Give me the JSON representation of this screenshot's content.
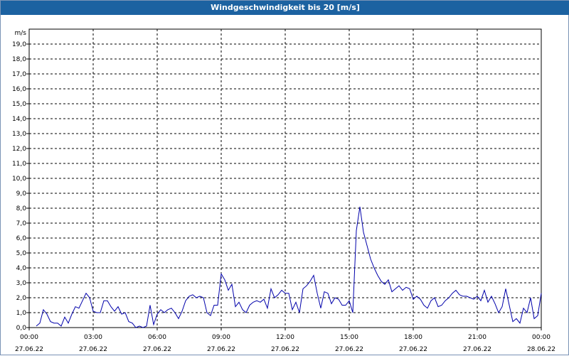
{
  "window": {
    "title": "Windgeschwindigkeit bis 20 [m/s]"
  },
  "colors": {
    "title_bar": "#1c62a1",
    "series": "#0000aa",
    "grid": "#000000"
  },
  "chart_data": {
    "type": "line",
    "title": "Windgeschwindigkeit bis 20 [m/s]",
    "ylabel": "m/s",
    "xlabel": "",
    "ylim": [
      0,
      20
    ],
    "xlim": [
      "2022-06-27 00:00",
      "2022-06-28 00:00"
    ],
    "grid": true,
    "y_ticks": [
      "0,0",
      "1,0",
      "2,0",
      "3,0",
      "4,0",
      "5,0",
      "6,0",
      "7,0",
      "8,0",
      "9,0",
      "10,0",
      "11,0",
      "12,0",
      "13,0",
      "14,0",
      "15,0",
      "16,0",
      "17,0",
      "18,0",
      "19,0"
    ],
    "x_ticks": [
      {
        "time": "00:00",
        "date": "27.06.22"
      },
      {
        "time": "03:00",
        "date": "27.06.22"
      },
      {
        "time": "06:00",
        "date": "27.06.22"
      },
      {
        "time": "09:00",
        "date": "27.06.22"
      },
      {
        "time": "12:00",
        "date": "27.06.22"
      },
      {
        "time": "15:00",
        "date": "27.06.22"
      },
      {
        "time": "18:00",
        "date": "27.06.22"
      },
      {
        "time": "21:00",
        "date": "27.06.22"
      },
      {
        "time": "00:00",
        "date": "28.06.22"
      }
    ],
    "series": [
      {
        "x": [
          "00:20",
          "00:30",
          "00:40",
          "00:50",
          "01:00",
          "01:10",
          "01:20",
          "01:30",
          "01:40",
          "01:50",
          "02:00",
          "02:10",
          "02:20",
          "02:30",
          "02:40",
          "02:50",
          "03:00",
          "03:10",
          "03:20",
          "03:30",
          "03:40",
          "03:50",
          "04:00",
          "04:10",
          "04:20",
          "04:30",
          "04:40",
          "04:50",
          "05:00",
          "05:10",
          "05:20",
          "05:30",
          "05:40",
          "05:50",
          "06:00",
          "06:10",
          "06:20",
          "06:30",
          "06:40",
          "06:50",
          "07:00",
          "07:10",
          "07:20",
          "07:30",
          "07:40",
          "07:50",
          "08:00",
          "08:10",
          "08:20",
          "08:30",
          "08:40",
          "08:50",
          "09:00",
          "09:10",
          "09:20",
          "09:30",
          "09:40",
          "09:50",
          "10:00",
          "10:10",
          "10:20",
          "10:30",
          "10:40",
          "10:50",
          "11:00",
          "11:10",
          "11:20",
          "11:30",
          "11:40",
          "11:50",
          "12:00",
          "12:10",
          "12:20",
          "12:30",
          "12:40",
          "12:50",
          "13:00",
          "13:10",
          "13:20",
          "13:30",
          "13:40",
          "13:50",
          "14:00",
          "14:10",
          "14:20",
          "14:30",
          "14:40",
          "14:50",
          "15:00",
          "15:10",
          "15:20",
          "15:30",
          "15:40",
          "15:50",
          "16:00",
          "16:10",
          "16:20",
          "16:30",
          "16:40",
          "16:50",
          "17:00",
          "17:10",
          "17:20",
          "17:30",
          "17:40",
          "17:50",
          "18:00",
          "18:10",
          "18:20",
          "18:30",
          "18:40",
          "18:50",
          "19:00",
          "19:10",
          "19:20",
          "19:30",
          "19:40",
          "19:50",
          "20:00",
          "20:10",
          "20:20",
          "20:30",
          "20:40",
          "20:50",
          "21:00",
          "21:10",
          "21:20",
          "21:30",
          "21:40",
          "21:50",
          "22:00",
          "22:10",
          "22:20",
          "22:30",
          "22:40",
          "22:50",
          "23:00",
          "23:10",
          "23:20",
          "23:30",
          "23:40",
          "23:50",
          "24:00"
        ],
        "y": [
          0.1,
          0.3,
          1.2,
          0.9,
          0.4,
          0.3,
          0.3,
          0.1,
          0.7,
          0.3,
          0.9,
          1.4,
          1.3,
          1.8,
          2.3,
          2.0,
          1.1,
          1.0,
          1.0,
          1.8,
          1.8,
          1.4,
          1.1,
          1.4,
          0.9,
          1.0,
          0.4,
          0.3,
          0.0,
          0.1,
          0.0,
          0.1,
          1.5,
          0.2,
          0.9,
          1.2,
          1.0,
          1.2,
          1.3,
          1.0,
          0.6,
          1.1,
          1.8,
          2.1,
          2.2,
          2.0,
          2.1,
          2.0,
          1.0,
          0.8,
          1.5,
          1.5,
          3.6,
          3.2,
          2.5,
          2.9,
          1.4,
          1.7,
          1.2,
          1.0,
          1.5,
          1.7,
          1.8,
          1.7,
          1.9,
          1.3,
          2.6,
          2.0,
          2.2,
          2.5,
          2.3,
          2.3,
          1.2,
          1.7,
          1.0,
          2.6,
          2.8,
          3.1,
          3.5,
          2.3,
          1.3,
          2.4,
          2.3,
          1.6,
          2.0,
          1.9,
          1.5,
          1.5,
          1.8,
          1.0,
          6.5,
          8.1,
          6.4,
          5.5,
          4.6,
          4.0,
          3.5,
          3.1,
          2.9,
          3.2,
          2.4,
          2.6,
          2.8,
          2.5,
          2.7,
          2.6,
          1.9,
          2.1,
          1.9,
          1.5,
          1.3,
          1.8,
          2.0,
          1.4,
          1.5,
          1.8,
          2.0,
          2.3,
          2.5,
          2.2,
          2.1,
          2.1,
          2.0,
          1.9,
          2.1,
          1.8,
          2.5,
          1.7,
          2.1,
          1.6,
          1.0,
          1.4,
          2.6,
          1.5,
          0.4,
          0.6,
          0.3,
          1.3,
          1.0,
          2.0,
          0.6,
          0.8,
          2.3
        ]
      }
    ]
  }
}
